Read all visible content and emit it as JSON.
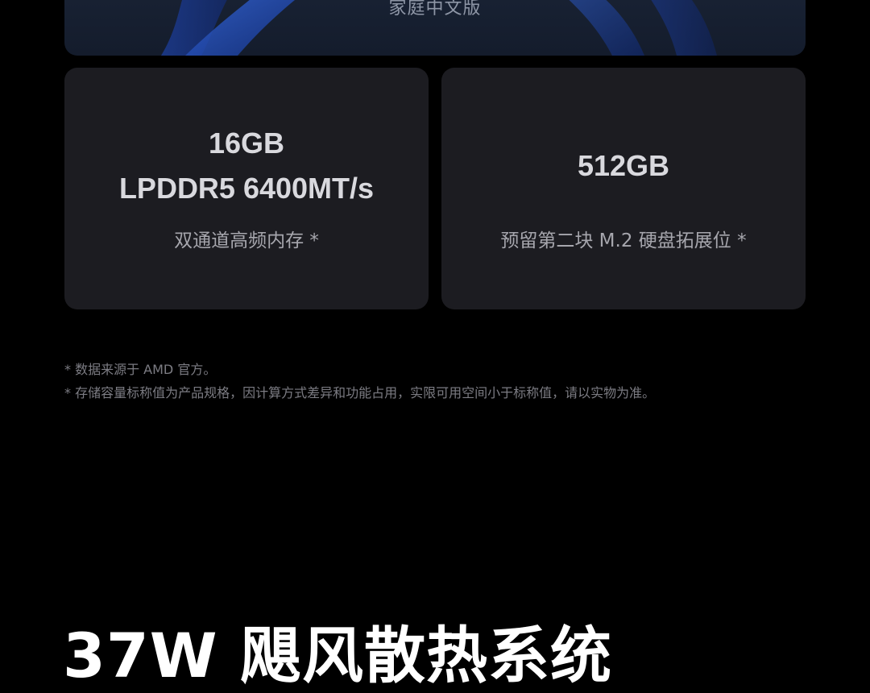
{
  "os_banner": {
    "label": "家庭中文版"
  },
  "cards": {
    "memory": {
      "title_line1": "16GB",
      "title_line2": "LPDDR5 6400MT/s",
      "subtitle": "双通道高频内存 *"
    },
    "storage": {
      "title": "512GB",
      "subtitle": "预留第二块 M.2 硬盘拓展位 *"
    }
  },
  "footnotes": [
    "* 数据来源于 AMD 官方。",
    "* 存储容量标称值为产品规格，因计算方式差异和功能占用，实限可用空间小于标称值，请以实物为准。"
  ],
  "section": {
    "title": "37W 飓风散热系统"
  },
  "colors": {
    "background": "#000000",
    "card": "#1c1c21",
    "banner_accent": "#2f5bd6"
  }
}
